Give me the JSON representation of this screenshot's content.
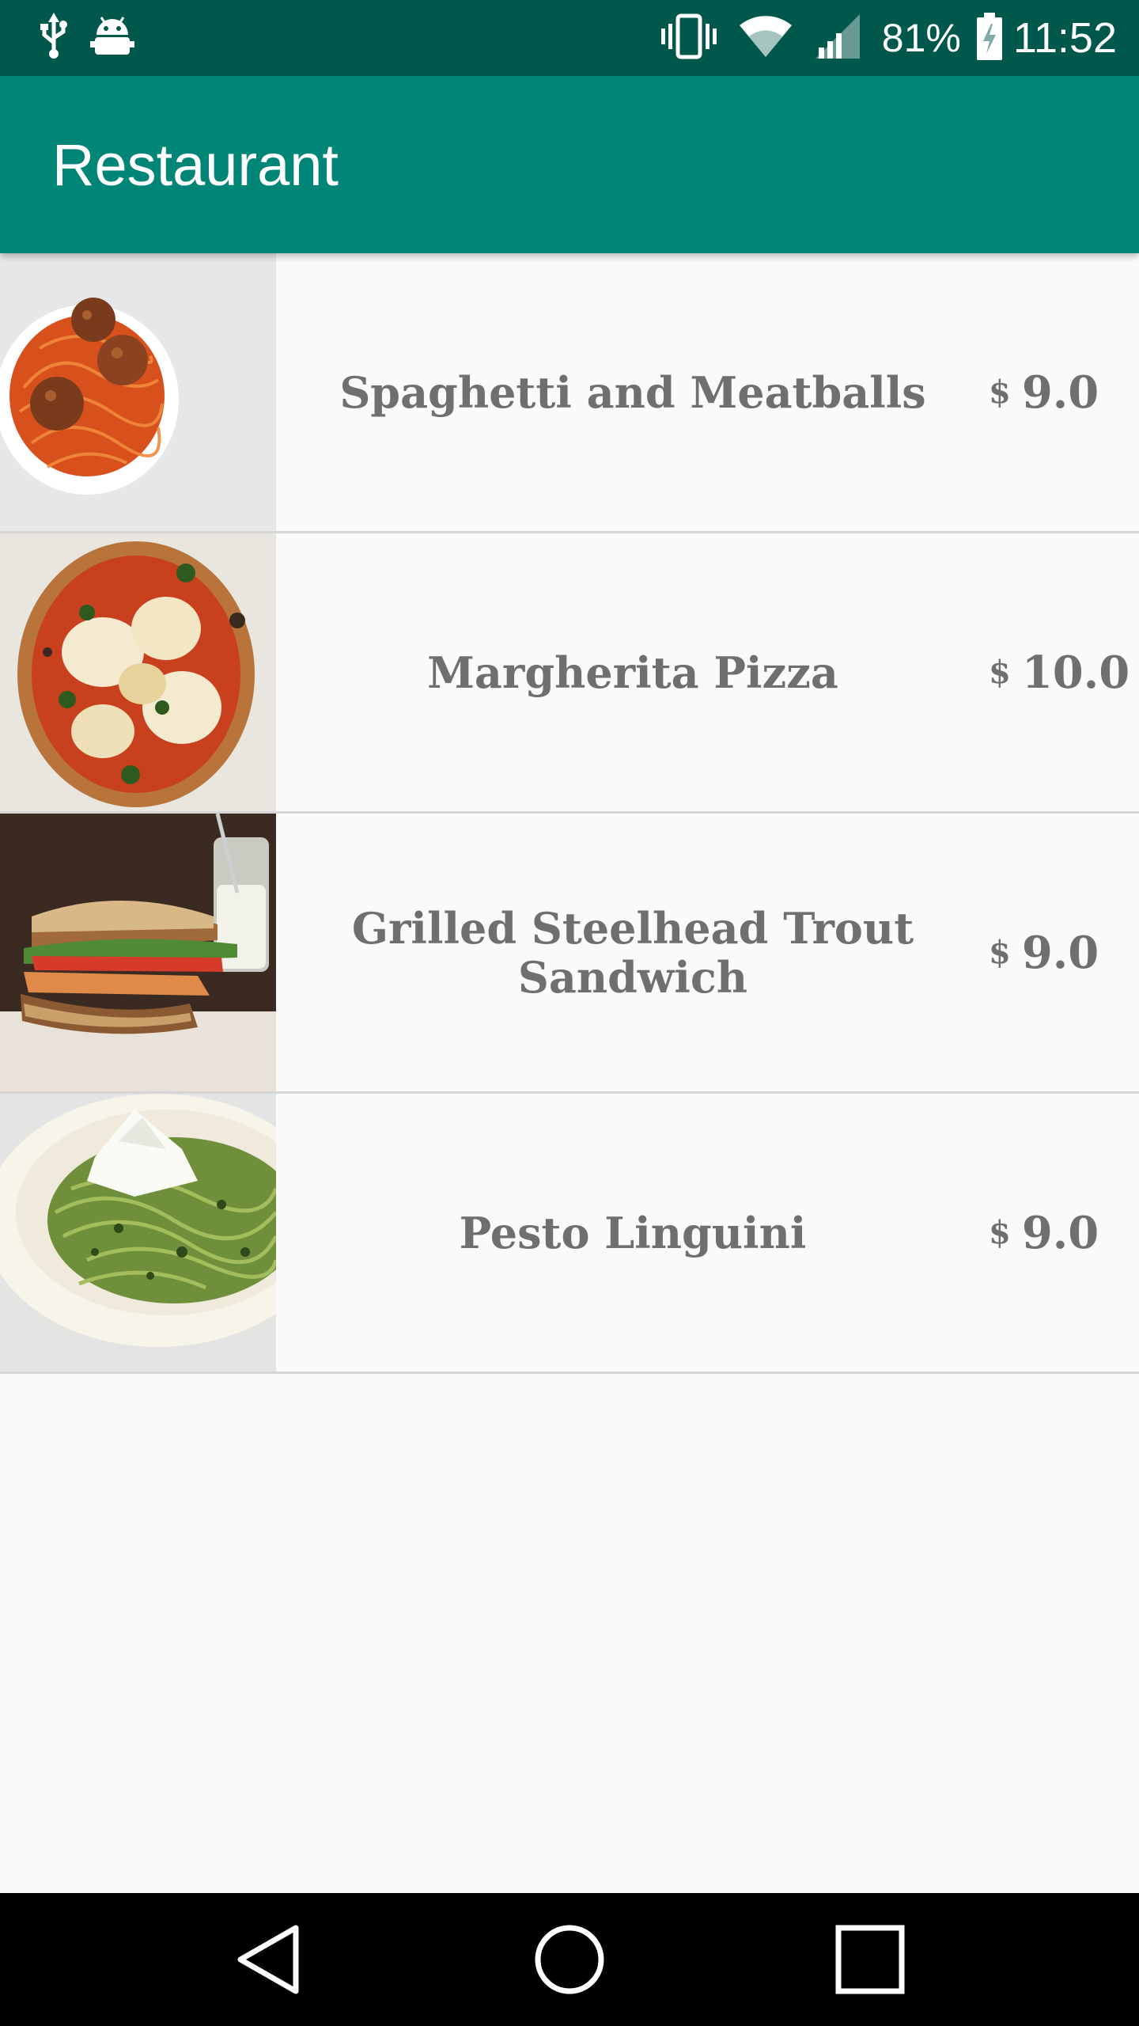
{
  "status_bar": {
    "icons_left": [
      "usb-icon",
      "android-debug-icon"
    ],
    "icons_right": [
      "vibrate-icon",
      "wifi-icon",
      "signal-icon",
      "battery-charging-icon"
    ],
    "battery": "81%",
    "time": "11:52"
  },
  "app_bar": {
    "title": "Restaurant"
  },
  "menu_items": [
    {
      "name": "Spaghetti and Meatballs",
      "currency": "$",
      "price": "9.0",
      "image": "spaghetti-meatballs-photo"
    },
    {
      "name": "Margherita Pizza",
      "currency": "$",
      "price": "10.0",
      "image": "margherita-pizza-photo"
    },
    {
      "name": "Grilled Steelhead Trout Sandwich",
      "currency": "$",
      "price": "9.0",
      "image": "trout-sandwich-photo"
    },
    {
      "name": "Pesto Linguini",
      "currency": "$",
      "price": "9.0",
      "image": "pesto-linguini-photo"
    }
  ],
  "nav_bar": {
    "icons": [
      "back-icon",
      "home-icon",
      "recents-icon"
    ]
  },
  "colors": {
    "status_bar": "#00574b",
    "app_bar": "#008577",
    "text_gray": "#6f6f6f"
  }
}
